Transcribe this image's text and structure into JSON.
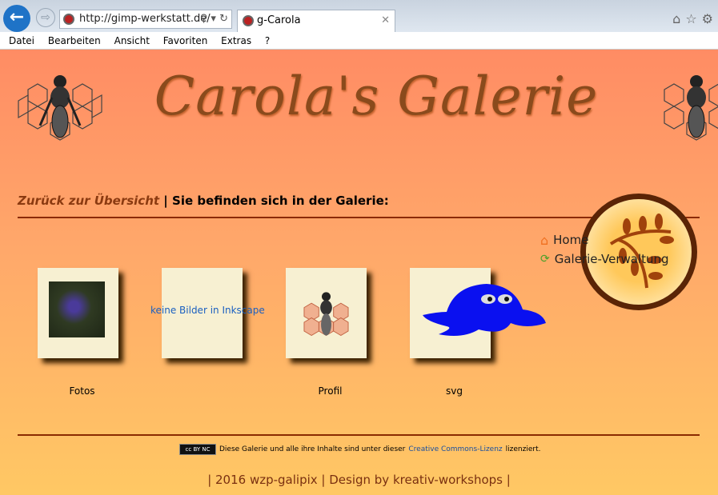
{
  "browser": {
    "url": "http://gimp-werkstatt.de/",
    "tab_title": "g-Carola",
    "menu": [
      "Datei",
      "Bearbeiten",
      "Ansicht",
      "Favoriten",
      "Extras",
      "?"
    ]
  },
  "header": {
    "title": "Carola's Galerie"
  },
  "breadcrumb": {
    "back_link": "Zurück zur Übersicht",
    "separator": "|",
    "text": "Sie befinden sich in der Galerie:"
  },
  "nav": {
    "items": [
      {
        "label": "Home",
        "icon": "home-icon"
      },
      {
        "label": "Galerie-Verwaltung",
        "icon": "refresh-icon"
      }
    ]
  },
  "albums": [
    {
      "label": "Fotos"
    },
    {
      "label": "",
      "empty_text": "keine Bilder in Inkscape"
    },
    {
      "label": "Profil"
    },
    {
      "label": "svg"
    }
  ],
  "footer": {
    "license_prefix": "Diese Galerie und alle ihre Inhalte sind unter dieser",
    "license_link": "Creative Commons-Lizenz",
    "license_suffix": "lizenziert.",
    "badge": "cc BY NC",
    "credits": "| 2016 wzp-galipix | Design by kreativ-workshops |"
  }
}
